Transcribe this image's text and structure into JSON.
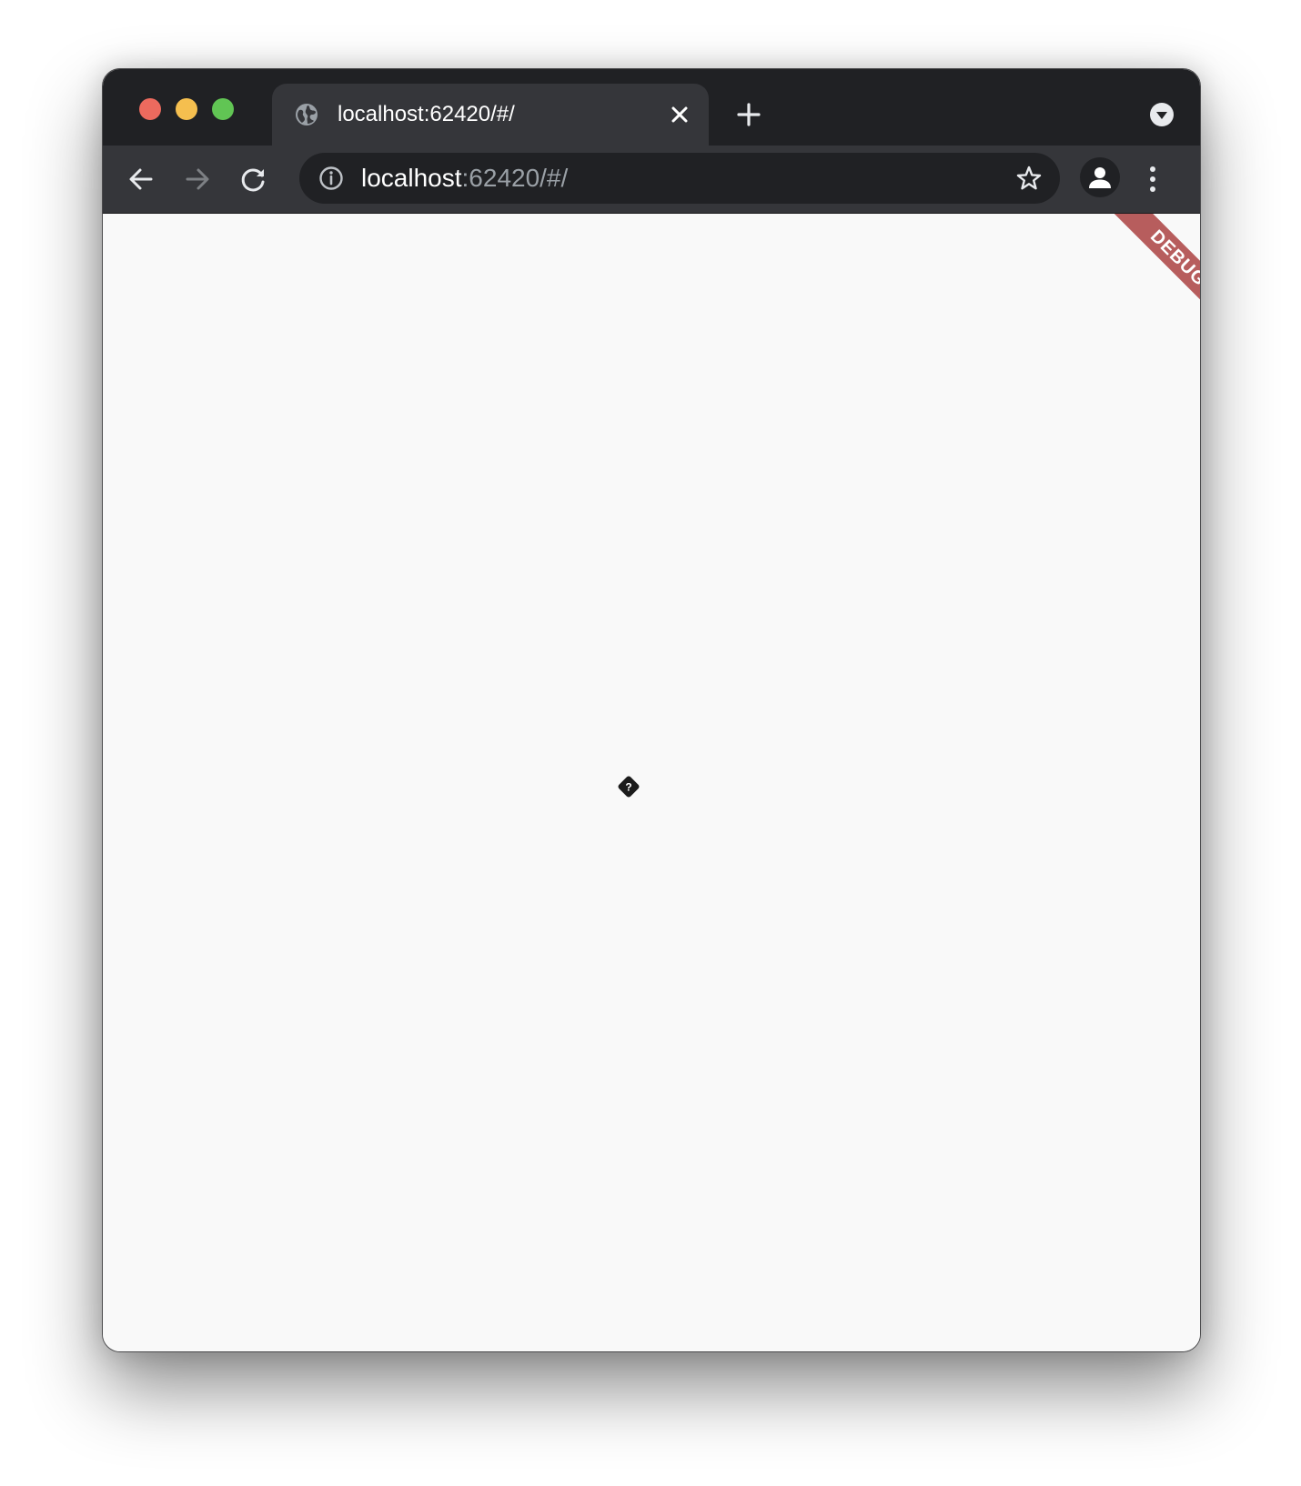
{
  "window": {
    "traffic_lights": {
      "close_color": "#ed6a5e",
      "minimize_color": "#f5bf4f",
      "zoom_color": "#61c554"
    }
  },
  "tabbar": {
    "active_tab": {
      "title": "localhost:62420/#/",
      "favicon": "globe-icon",
      "close_icon": "close-icon"
    },
    "new_tab_icon": "plus-icon",
    "tab_search_icon": "chevron-down-circle-icon"
  },
  "toolbar": {
    "back_icon": "arrow-left-icon",
    "forward_icon": "arrow-right-icon",
    "reload_icon": "reload-icon",
    "omnibox": {
      "info_icon": "info-icon",
      "url_host": "localhost",
      "url_rest": ":62420/#/",
      "bookmark_icon": "star-icon"
    },
    "profile_icon": "person-icon",
    "menu_icon": "more-vert-icon"
  },
  "content": {
    "debug_banner": "DEBUG",
    "banner_color": "#a02828",
    "missing_glyph": "?",
    "background": "#f9f9f9"
  }
}
